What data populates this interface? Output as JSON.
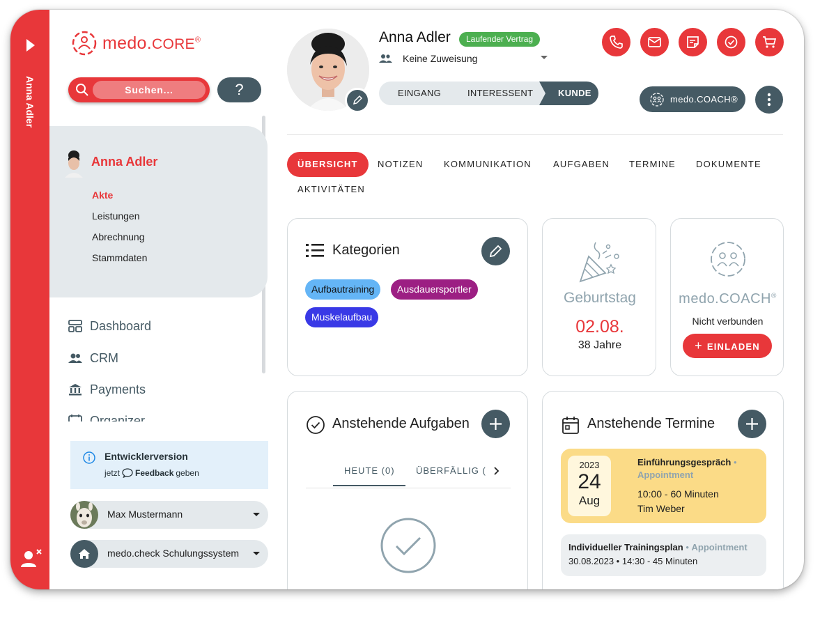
{
  "app": {
    "brand": "medo.",
    "brand_core": "CORE",
    "registered": "®"
  },
  "rail": {
    "vertical_name": "Anna Adler"
  },
  "search": {
    "label": "Suchen...",
    "help_label": "?"
  },
  "patient_nav": {
    "name": "Anna Adler",
    "links": [
      {
        "label": "Akte",
        "active": true
      },
      {
        "label": "Leistungen",
        "active": false
      },
      {
        "label": "Abrechnung",
        "active": false
      },
      {
        "label": "Stammdaten",
        "active": false
      }
    ]
  },
  "main_nav": [
    {
      "label": "Dashboard",
      "icon": "dashboard-icon"
    },
    {
      "label": "CRM",
      "icon": "people-icon"
    },
    {
      "label": "Payments",
      "icon": "bank-icon"
    },
    {
      "label": "Organizer",
      "icon": "calendar-icon"
    }
  ],
  "dev_notice": {
    "title": "Entwicklerversion",
    "prefix": "jetzt",
    "link": "Feedback",
    "suffix": "geben"
  },
  "user_selector": {
    "label": "Max Mustermann"
  },
  "system_selector": {
    "label": "medo.check Schulungssystem"
  },
  "profile": {
    "name": "Anna Adler",
    "status": "Laufender Vertrag",
    "assignment": "Keine Zuweisung",
    "stages": [
      "EINGANG",
      "INTERESSENT",
      "KUNDE"
    ],
    "active_stage": "KUNDE"
  },
  "coach_button": {
    "label": "medo.COACH®"
  },
  "tabs": [
    "ÜBERSICHT",
    "NOTIZEN",
    "KOMMUNIKATION",
    "AUFGABEN",
    "TERMINE",
    "DOKUMENTE",
    "AKTIVITÄTEN"
  ],
  "active_tab": "ÜBERSICHT",
  "categories": {
    "title": "Kategorien",
    "chips": [
      {
        "label": "Aufbautraining",
        "bg": "#64b5f6",
        "fg": "#111111"
      },
      {
        "label": "Ausdauersportler",
        "bg": "#9c1f83",
        "fg": "#ffffff"
      },
      {
        "label": "Muskelaufbau",
        "bg": "#3939e6",
        "fg": "#ffffff"
      }
    ]
  },
  "birthday": {
    "title": "Geburtstag",
    "date": "02.08.",
    "age": "38 Jahre"
  },
  "coach_card": {
    "brand": "medo.COACH",
    "registered": "®",
    "status": "Nicht verbunden",
    "invite_label": "EINLADEN"
  },
  "tasks": {
    "title": "Anstehende Aufgaben",
    "subtabs": [
      "HEUTE (0)",
      "ÜBERFÄLLIG ("
    ]
  },
  "appointments": {
    "title": "Anstehende Termine",
    "featured": {
      "year": "2023",
      "day": "24",
      "month": "Aug",
      "title": "Einführungsgespräch",
      "type": "Appointment",
      "time": "10:00 - 60 Minuten",
      "person": "Tim Weber"
    },
    "next": {
      "title": "Individueller Trainingsplan",
      "type": "Appointment",
      "detail": "30.08.2023 • 14:30 - 45 Minuten"
    }
  },
  "colors": {
    "accent": "#e8373a",
    "slate": "#455a64",
    "success": "#4caf50",
    "panel": "#e4e9ec"
  }
}
